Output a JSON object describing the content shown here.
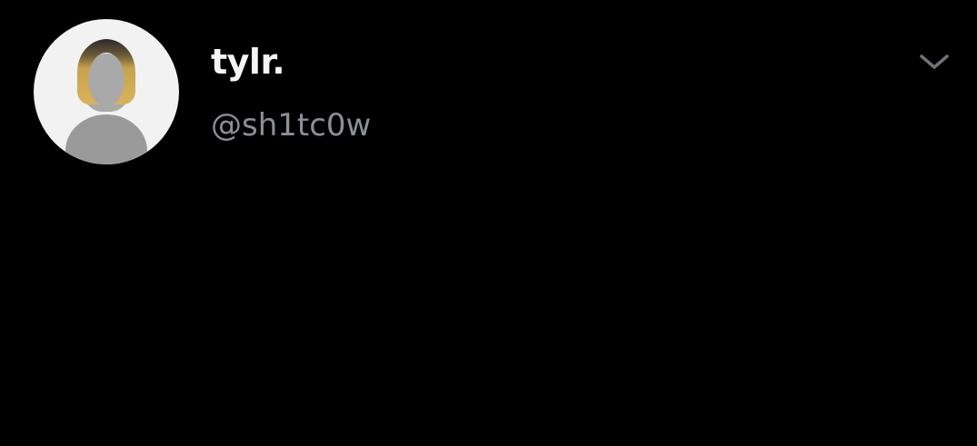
{
  "tweet": {
    "author_name": "tylr.",
    "handle": "@sh1tc0w",
    "menu_icon": "chevron-down-icon",
    "body": ""
  },
  "colors": {
    "background": "#000000",
    "name": "#f5f5f5",
    "handle": "#8b9096",
    "text": "#f2f2f2"
  }
}
